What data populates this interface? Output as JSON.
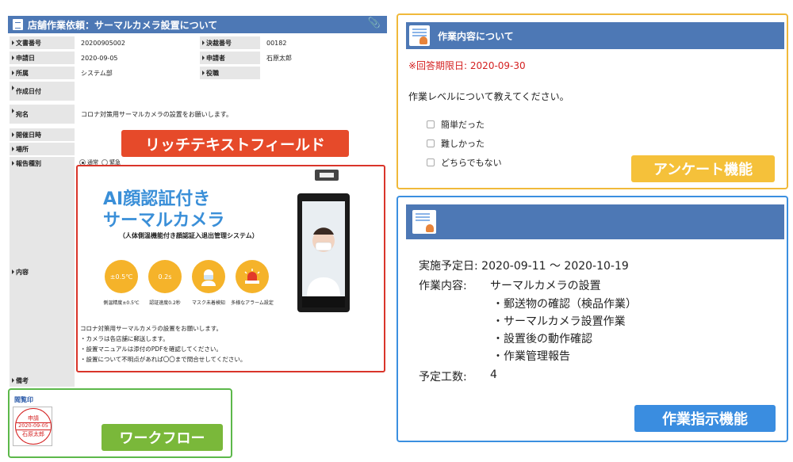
{
  "form": {
    "title": "店舗作業依頼：サーマルカメラ設置について",
    "rows": {
      "doc_no_label": "文書番号",
      "doc_no": "20200905002",
      "decision_no_label": "決裁番号",
      "decision_no": "00182",
      "apply_date_label": "申請日",
      "apply_date": "2020-09-05",
      "applicant_label": "申請者",
      "applicant": "石原太郎",
      "dept_label": "所属",
      "dept": "システム部",
      "role_label": "役職",
      "created_label": "作成日付",
      "to_label": "宛名",
      "to": "コロナ対策用サーマルカメラの設置をお願いします。",
      "datetime_label": "開催日時",
      "place_label": "場所",
      "report_type_label": "報告種別",
      "report_normal": "通常",
      "report_urgent": "緊急",
      "content_label": "内容",
      "memo_label": "備考"
    }
  },
  "richtext": {
    "tag": "リッチテキストフィールド",
    "ai_line1": "AI顔認証付き",
    "ai_line2": "サーマルカメラ",
    "ai_sub": "（人体側温機能付き顔認証入退出管理システム）",
    "badges": [
      {
        "icon": "±0.5℃",
        "caption": "側温精度±0.5℃"
      },
      {
        "icon": "0.2s",
        "caption": "認証速度0.2秒"
      },
      {
        "icon": "",
        "caption": "マスク未着検知"
      },
      {
        "icon": "",
        "caption": "多様なアラーム設定"
      }
    ],
    "notes": [
      "コロナ対策用サーマルカメラの設置をお願いします。",
      "・カメラは各店舗に郵送します。",
      "・設置マニュアルは添付のPDFを確認してください。",
      "・設置について不明点があれば〇〇まで問合せしてください。"
    ]
  },
  "workflow": {
    "tag": "ワークフロー",
    "title": "閲覧印",
    "stamp_top": "申請",
    "stamp_date": "2020-09-05",
    "stamp_name": "石原太郎"
  },
  "survey": {
    "title": "作業内容について",
    "deadline": "※回答期限日: 2020-09-30",
    "question": "作業レベルについて教えてください。",
    "options": [
      "簡単だった",
      "難しかった",
      "どちらでもない"
    ],
    "tag": "アンケート機能"
  },
  "task": {
    "schedule": "実施予定日: 2020-09-11 ～ 2020-10-19",
    "content_label": "作業内容:",
    "content_main": "サーマルカメラの設置",
    "items": [
      "・郵送物の確認（検品作業）",
      "・サーマルカメラ設置作業",
      "・設置後の動作確認",
      "・作業管理報告"
    ],
    "effort_label": "予定工数:",
    "effort": "4",
    "tag": "作業指示機能"
  }
}
